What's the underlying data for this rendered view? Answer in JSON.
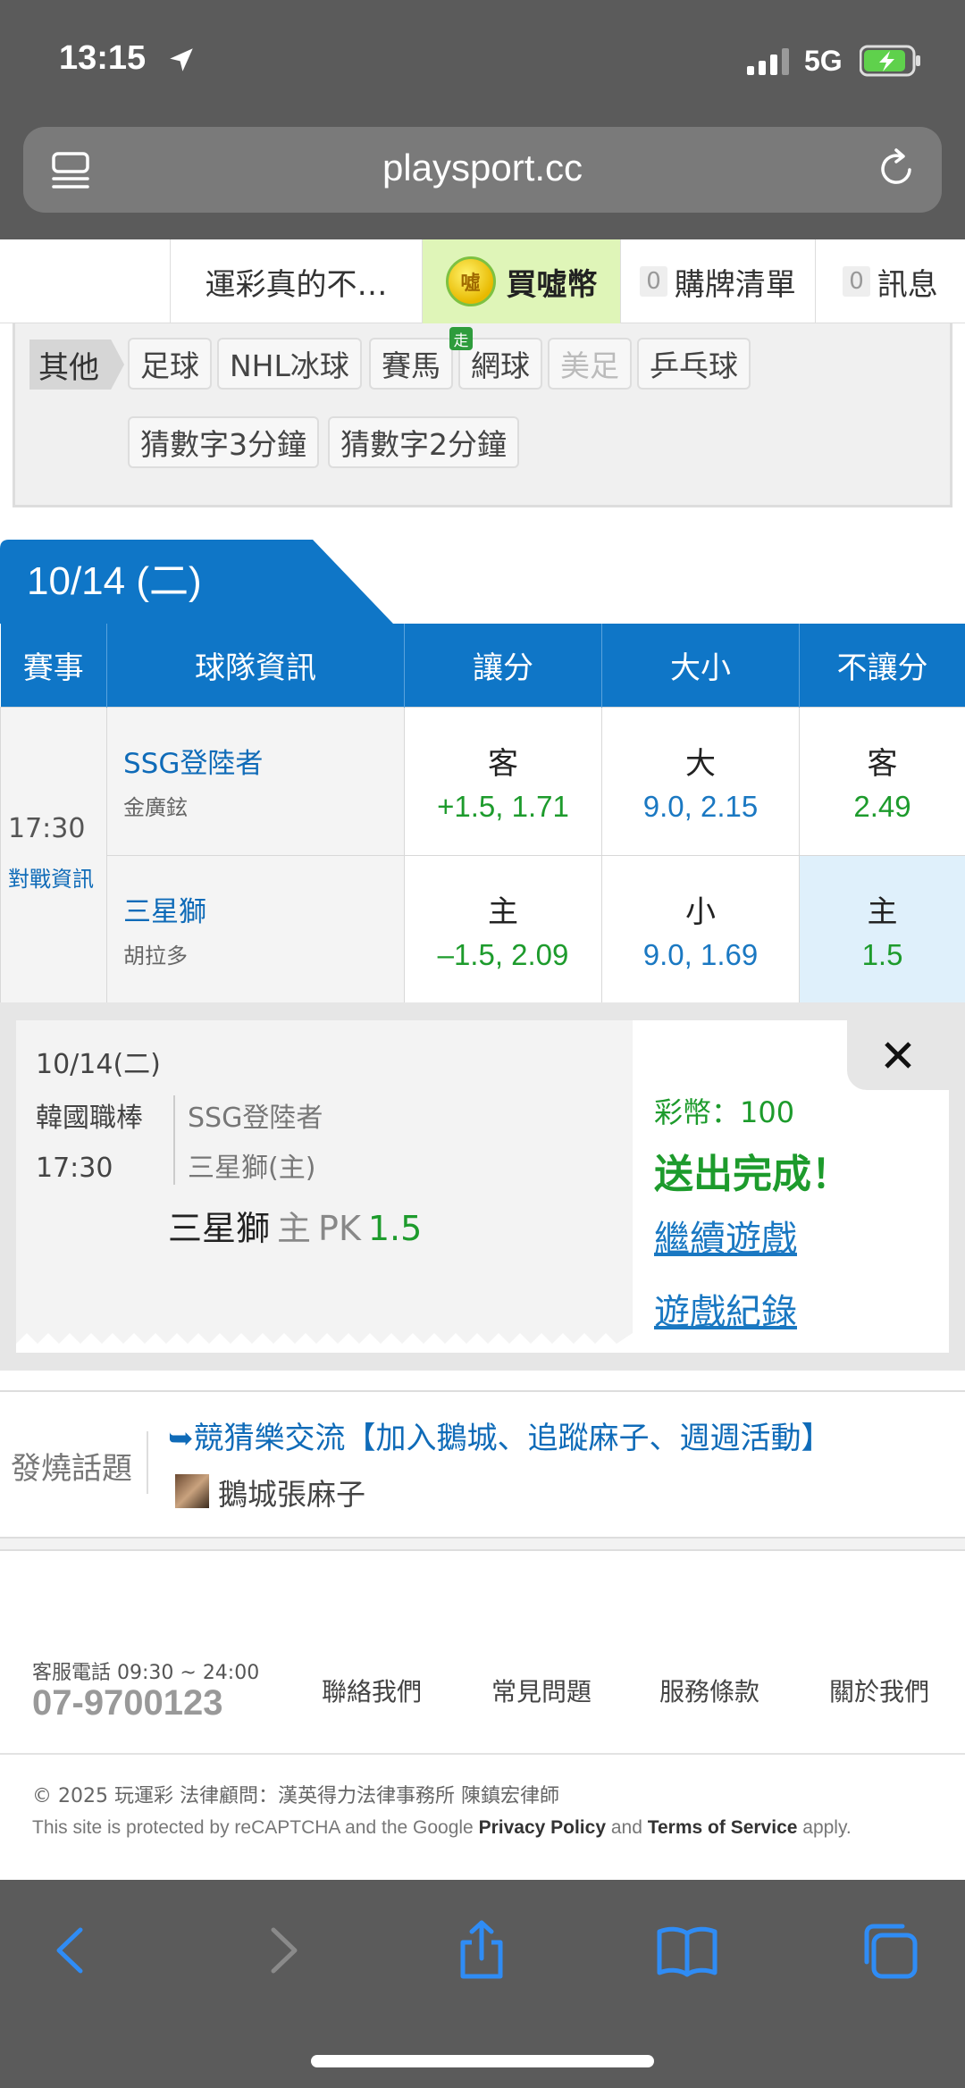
{
  "status": {
    "time": "13:15",
    "network": "5G"
  },
  "browser": {
    "url": "playsport.cc"
  },
  "nav": {
    "topic": "運彩真的不…",
    "coin_glyph": "噓",
    "buy": "買噓幣",
    "list_count": "0",
    "list": "購牌清單",
    "msg_count": "0",
    "msg": "訊息"
  },
  "categories": {
    "other": "其他",
    "items": [
      "足球",
      "NHL冰球",
      "賽馬",
      "網球",
      "美足",
      "乒乓球",
      "猜數字3分鐘",
      "猜數字2分鐘"
    ],
    "badge": "走"
  },
  "date_tab": "10/14 (二)",
  "table": {
    "headers": [
      "賽事",
      "球隊資訊",
      "讓分",
      "大小",
      "不讓分"
    ],
    "time": "17:30",
    "vs_link": "對戰資訊",
    "rows": [
      {
        "team": "SSG登陸者",
        "pitcher": "金廣鉉",
        "spread_side": "客",
        "spread": "+1.5, 1.71",
        "total_side": "大",
        "total": "9.0, 2.15",
        "ml_side": "客",
        "ml": "2.49"
      },
      {
        "team": "三星獅",
        "pitcher": "胡拉多",
        "spread_side": "主",
        "spread": "–1.5, 2.09",
        "total_side": "小",
        "total": "9.0, 1.69",
        "ml_side": "主",
        "ml": "1.5"
      }
    ]
  },
  "result": {
    "date": "10/14(二)",
    "league": "韓國職棒",
    "time": "17:30",
    "team1": "SSG登陸者",
    "team2": "三星獅(主)",
    "pick_team": "三星獅",
    "pick_side": "主",
    "pick_type": "PK",
    "pick_odds": "1.5",
    "coins": "彩幣：100",
    "done": "送出完成！",
    "continue": "繼續遊戲",
    "record": "遊戲紀錄"
  },
  "hot": {
    "label": "發燒話題",
    "title": "➥競猜樂交流【加入鵝城、追蹤麻子、週週活動】",
    "author": "鵝城張麻子"
  },
  "footer": {
    "hours": "客服電話 09:30 ~ 24:00",
    "phone": "07-9700123",
    "links": [
      "聯絡我們",
      "常見問題",
      "服務條款",
      "關於我們"
    ],
    "copyright": "© 2025 玩運彩 法律顧問：漢英得力法律事務所 陳鎮宏律師",
    "recaptcha_pre": "This site is protected by reCAPTCHA and the Google ",
    "privacy": "Privacy Policy",
    "and": " and ",
    "terms": "Terms of Service",
    "apply": " apply."
  },
  "colors": {
    "brand_blue": "#0f76c7",
    "green": "#1d9b2c",
    "link_blue": "#1a78c2"
  }
}
